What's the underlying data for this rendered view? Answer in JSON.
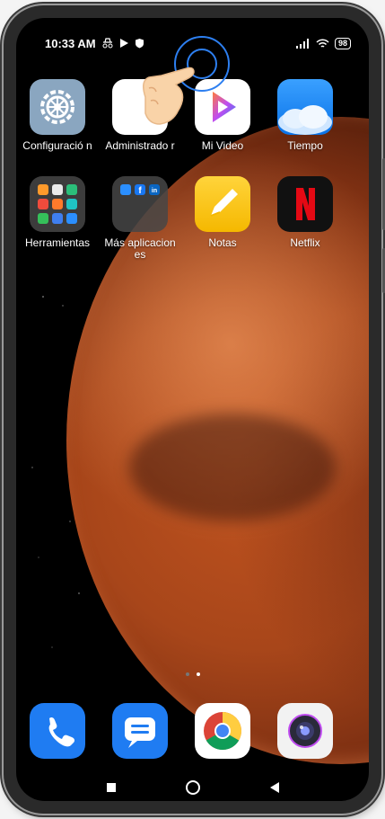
{
  "status_bar": {
    "time": "10:33 AM",
    "battery": "98"
  },
  "apps_row1": [
    {
      "label": "Configuració n",
      "icon": "settings-gear-icon"
    },
    {
      "label": "Administrado r",
      "icon": "admin-icon"
    },
    {
      "label": "Mi Video",
      "icon": "play-video-icon"
    },
    {
      "label": "Tiempo",
      "icon": "weather-cloud-icon"
    }
  ],
  "apps_row2": [
    {
      "label": "Herramientas",
      "icon": "tools-folder-icon"
    },
    {
      "label": "Más aplicaciones",
      "icon": "more-apps-folder-icon"
    },
    {
      "label": "Notas",
      "icon": "notes-pencil-icon"
    },
    {
      "label": "Netflix",
      "icon": "netflix-n-icon"
    }
  ],
  "dock": [
    {
      "icon": "phone-icon"
    },
    {
      "icon": "messages-icon"
    },
    {
      "icon": "chrome-icon"
    },
    {
      "icon": "camera-icon"
    }
  ],
  "page_indicator": {
    "pages": 2,
    "current": 2
  },
  "navbar": [
    "recents-square-icon",
    "home-circle-icon",
    "back-triangle-icon"
  ],
  "colors": {
    "accent_blue": "#2d7ff0",
    "mars": "#a8461a",
    "netflix_red": "#e50914"
  }
}
